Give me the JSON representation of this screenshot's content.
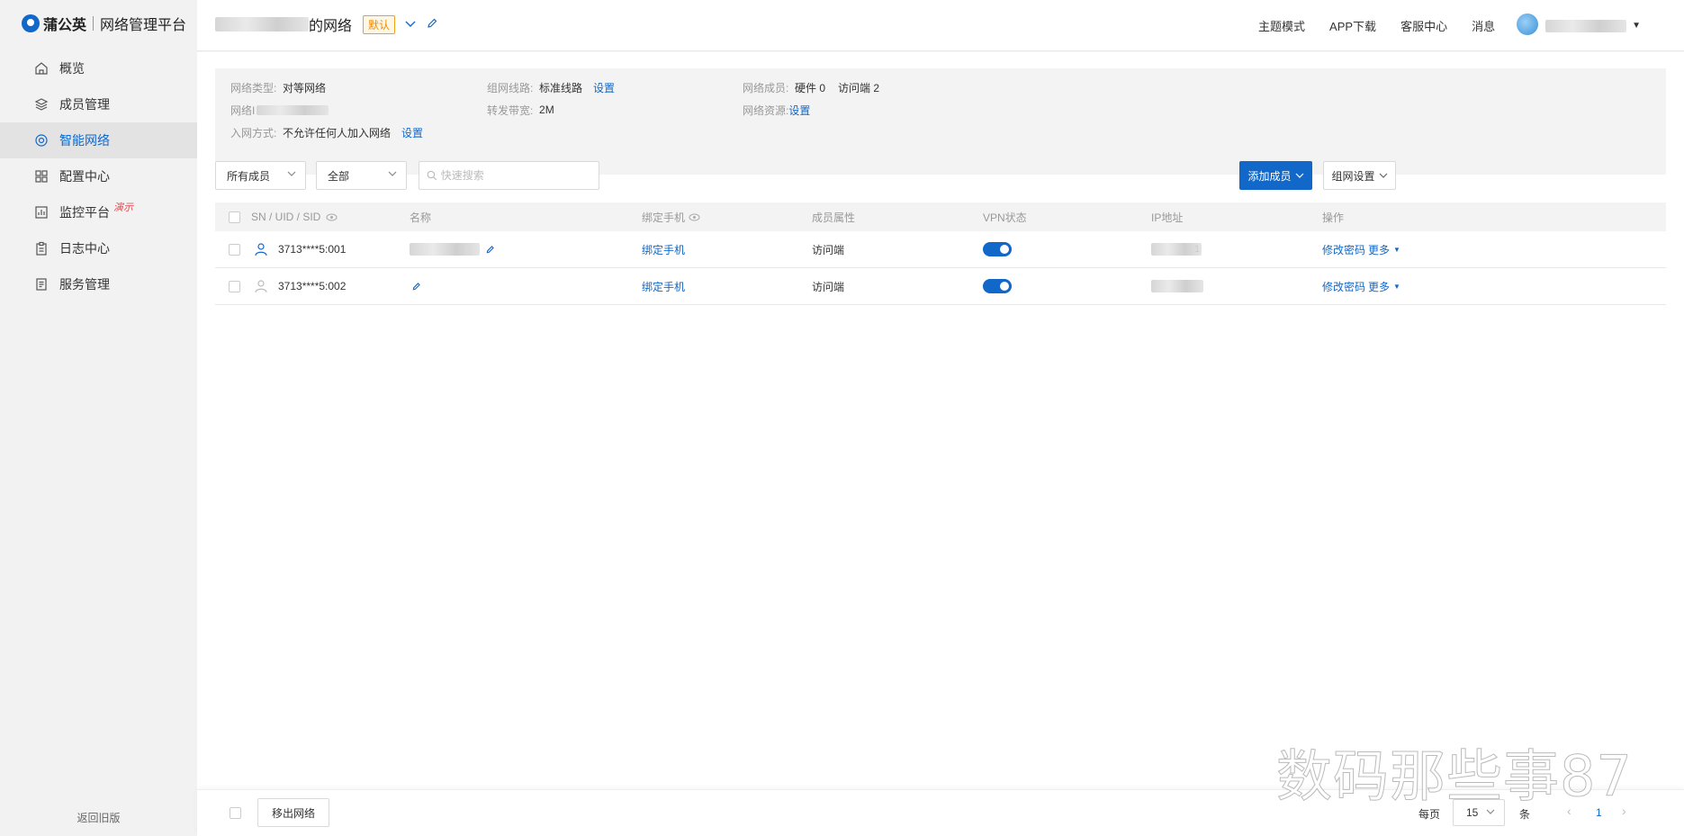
{
  "brand": {
    "name": "蒲公英",
    "subtitle": "网络管理平台"
  },
  "sidebar": {
    "items": [
      {
        "label": "概览",
        "icon": "home-icon"
      },
      {
        "label": "成员管理",
        "icon": "layers-icon"
      },
      {
        "label": "智能网络",
        "icon": "network-icon",
        "active": true
      },
      {
        "label": "配置中心",
        "icon": "grid-icon"
      },
      {
        "label": "监控平台",
        "icon": "monitor-icon",
        "badge": "演示"
      },
      {
        "label": "日志中心",
        "icon": "clipboard-icon"
      },
      {
        "label": "服务管理",
        "icon": "document-icon"
      }
    ],
    "back_old": "返回旧版"
  },
  "header": {
    "network_title_suffix": "的网络",
    "default_tag": "默认",
    "links": [
      "主题模式",
      "APP下载",
      "客服中心",
      "消息"
    ]
  },
  "info": {
    "type_label": "网络类型:",
    "type_value": "对等网络",
    "id_label": "网络I",
    "join_label": "入网方式:",
    "join_value": "不允许任何人加入网络",
    "join_link": "设置",
    "route_label": "组网线路:",
    "route_value": "标准线路",
    "route_link": "设置",
    "bandwidth_label": "转发带宽:",
    "bandwidth_value": "2M",
    "members_label": "网络成员:",
    "members_hw": "硬件 0",
    "members_access": "访问端 2",
    "resources_label": "网络资源:",
    "resources_link": "设置"
  },
  "filters": {
    "member_select": "所有成员",
    "status_select": "全部",
    "search_placeholder": "快速搜索",
    "add_member": "添加成员",
    "network_settings": "组网设置"
  },
  "table": {
    "columns": [
      "SN / UID / SID",
      "名称",
      "绑定手机",
      "成员属性",
      "VPN状态",
      "IP地址",
      "操作"
    ],
    "rows": [
      {
        "sn": "3713****5:001",
        "phone": "绑定手机",
        "attr": "访问端",
        "vpn": true,
        "action1": "修改密码",
        "action2": "更多",
        "ip_suffix": "1"
      },
      {
        "sn": "3713****5:002",
        "phone": "绑定手机",
        "attr": "访问端",
        "vpn": true,
        "action1": "修改密码",
        "action2": "更多",
        "ip_suffix": ""
      }
    ]
  },
  "footer": {
    "remove_button": "移出网络",
    "per_page_label": "每页",
    "per_page_value": "15",
    "per_page_unit": "条",
    "current_page": "1"
  },
  "watermark": "数码那些事87",
  "colors": {
    "primary": "#1268c8",
    "tag": "#f08a00",
    "badge": "#e5484d"
  }
}
